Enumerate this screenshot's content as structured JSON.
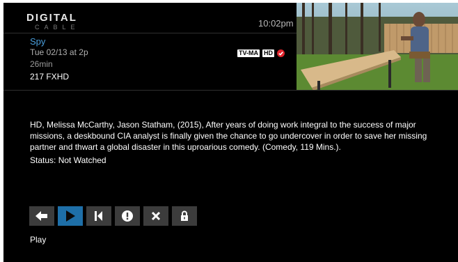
{
  "header": {
    "logo_top": "DIGITAL",
    "logo_bottom": "CABLE",
    "clock": "10:02pm"
  },
  "program": {
    "title": "Spy",
    "date": "Tue 02/13 at 2p",
    "duration": "26min",
    "channel": "217 FXHD",
    "rating": "TV-MA",
    "format": "HD",
    "recorded_icon": "checkmark-circle-icon"
  },
  "details": {
    "description": "HD, Melissa McCarthy, Jason Statham, (2015), After years of doing work integral to the success of major missions, a deskbound CIA analyst is finally given the chance to go undercover in order to save her missing partner and thwart a global disaster in this uproarious comedy. (Comedy, 119 Mins.).",
    "status": "Status: Not Watched"
  },
  "controls": {
    "items": [
      {
        "icon": "arrow-left-icon"
      },
      {
        "icon": "play-icon",
        "selected": true
      },
      {
        "icon": "skip-to-start-icon"
      },
      {
        "icon": "alert-icon"
      },
      {
        "icon": "delete-x-icon"
      },
      {
        "icon": "lock-icon"
      }
    ],
    "focused_label": "Play"
  },
  "colors": {
    "accent": "#1e6fa8",
    "title": "#4a9fdc",
    "record": "#e0242c",
    "button": "#3c3c3c",
    "background": "#000000"
  }
}
